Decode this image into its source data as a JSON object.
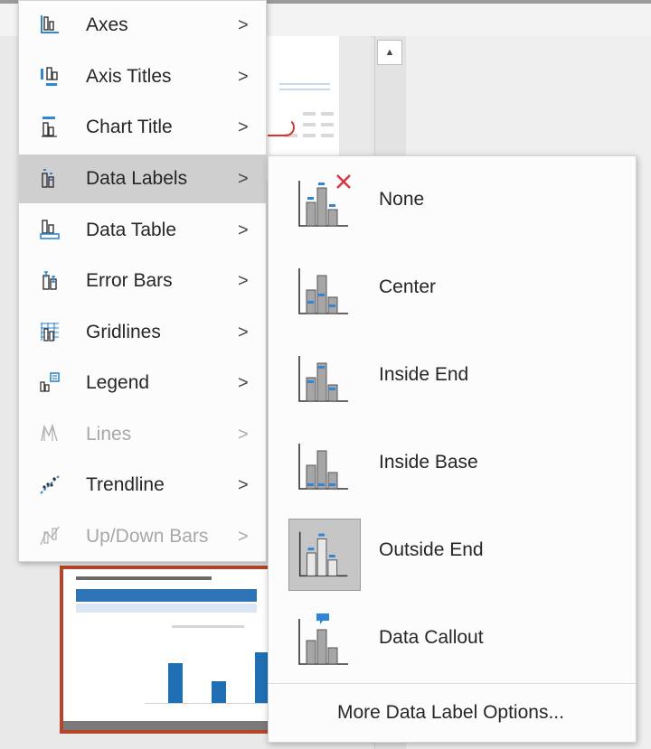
{
  "menu": {
    "items": [
      {
        "label": "Axes",
        "icon": "axes-icon",
        "has_submenu": true,
        "enabled": true
      },
      {
        "label": "Axis Titles",
        "icon": "axis-titles-icon",
        "has_submenu": true,
        "enabled": true
      },
      {
        "label": "Chart Title",
        "icon": "chart-title-icon",
        "has_submenu": true,
        "enabled": true
      },
      {
        "label": "Data Labels",
        "icon": "data-labels-icon",
        "has_submenu": true,
        "enabled": true,
        "selected": true
      },
      {
        "label": "Data Table",
        "icon": "data-table-icon",
        "has_submenu": true,
        "enabled": true
      },
      {
        "label": "Error Bars",
        "icon": "error-bars-icon",
        "has_submenu": true,
        "enabled": true
      },
      {
        "label": "Gridlines",
        "icon": "gridlines-icon",
        "has_submenu": true,
        "enabled": true
      },
      {
        "label": "Legend",
        "icon": "legend-icon",
        "has_submenu": true,
        "enabled": true
      },
      {
        "label": "Lines",
        "icon": "lines-icon",
        "has_submenu": true,
        "enabled": false
      },
      {
        "label": "Trendline",
        "icon": "trendline-icon",
        "has_submenu": true,
        "enabled": true
      },
      {
        "label": "Up/Down Bars",
        "icon": "up-down-bars-icon",
        "has_submenu": true,
        "enabled": false
      }
    ],
    "chevron": ">"
  },
  "submenu": {
    "items": [
      {
        "label": "None",
        "icon": "data-labels-none-icon"
      },
      {
        "label": "Center",
        "icon": "data-labels-center-icon"
      },
      {
        "label": "Inside End",
        "icon": "data-labels-inside-end-icon"
      },
      {
        "label": "Inside Base",
        "icon": "data-labels-inside-base-icon"
      },
      {
        "label": "Outside End",
        "icon": "data-labels-outside-end-icon",
        "selected": true
      },
      {
        "label": "Data Callout",
        "icon": "data-callout-icon"
      }
    ],
    "more_options": "More Data Label Options..."
  },
  "scrollbar": {
    "up_arrow": "▲"
  },
  "colors": {
    "accent_blue": "#2e86d6",
    "bar_gray": "#a6a6a6",
    "selected_bg": "#cfcfcf",
    "none_x_red": "#e0303a",
    "slide_border": "#b5462a"
  }
}
